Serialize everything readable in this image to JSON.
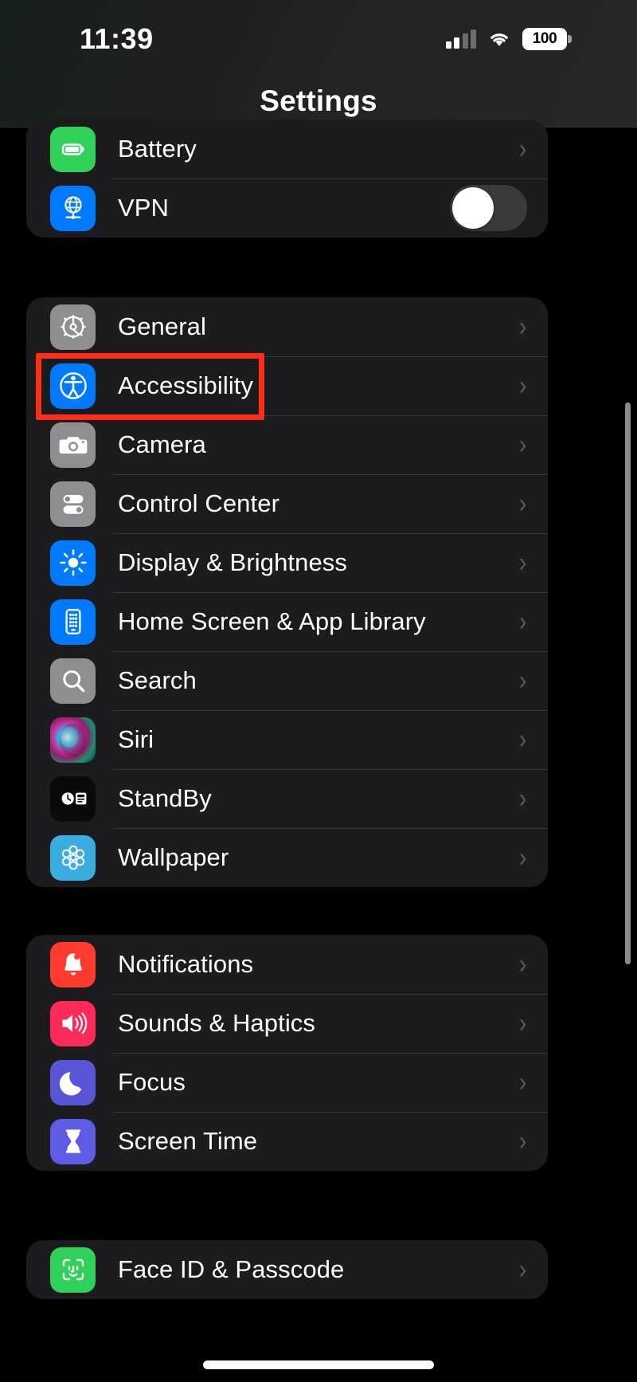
{
  "status_bar": {
    "time": "11:39",
    "cellular_icon": "cellular-signal-icon",
    "wifi_icon": "wifi-icon",
    "battery_percent": "100",
    "battery_icon": "battery-full-icon"
  },
  "nav": {
    "title": "Settings"
  },
  "highlight": {
    "target": "Accessibility",
    "color": "#ff2d16"
  },
  "sections": [
    {
      "id": "section-battery-vpn",
      "rows": [
        {
          "label": "Battery",
          "icon": "battery-icon",
          "icon_bg": "#30d158",
          "accessory": "chevron"
        },
        {
          "label": "VPN",
          "icon": "vpn-globe-icon",
          "icon_bg": "#007aff",
          "accessory": "toggle",
          "toggle_on": false
        }
      ]
    },
    {
      "id": "section-system",
      "rows": [
        {
          "label": "General",
          "icon": "gear-icon",
          "icon_bg": "#8e8e93",
          "accessory": "chevron"
        },
        {
          "label": "Accessibility",
          "icon": "accessibility-icon",
          "icon_bg": "#007aff",
          "accessory": "chevron"
        },
        {
          "label": "Camera",
          "icon": "camera-icon",
          "icon_bg": "#8e8e93",
          "accessory": "chevron"
        },
        {
          "label": "Control Center",
          "icon": "control-center-icon",
          "icon_bg": "#8e8e93",
          "accessory": "chevron"
        },
        {
          "label": "Display & Brightness",
          "icon": "brightness-sun-icon",
          "icon_bg": "#007aff",
          "accessory": "chevron"
        },
        {
          "label": "Home Screen & App Library",
          "icon": "home-screen-icon",
          "icon_bg": "#007aff",
          "accessory": "chevron"
        },
        {
          "label": "Search",
          "icon": "search-icon",
          "icon_bg": "#8e8e93",
          "accessory": "chevron"
        },
        {
          "label": "Siri",
          "icon": "siri-orb-icon",
          "icon_bg": "#2a1230",
          "accessory": "chevron"
        },
        {
          "label": "StandBy",
          "icon": "standby-clock-icon",
          "icon_bg": "#0a0a0a",
          "accessory": "chevron"
        },
        {
          "label": "Wallpaper",
          "icon": "wallpaper-flower-icon",
          "icon_bg": "#3aaee0",
          "accessory": "chevron"
        }
      ]
    },
    {
      "id": "section-notifications",
      "rows": [
        {
          "label": "Notifications",
          "icon": "bell-icon",
          "icon_bg": "#ff3b30",
          "accessory": "chevron"
        },
        {
          "label": "Sounds & Haptics",
          "icon": "speaker-icon",
          "icon_bg": "#fa2a5a",
          "accessory": "chevron"
        },
        {
          "label": "Focus",
          "icon": "moon-icon",
          "icon_bg": "#5856d6",
          "accessory": "chevron"
        },
        {
          "label": "Screen Time",
          "icon": "hourglass-icon",
          "icon_bg": "#5e5ce6",
          "accessory": "chevron"
        }
      ]
    },
    {
      "id": "section-security",
      "rows": [
        {
          "label": "Face ID & Passcode",
          "icon": "face-id-icon",
          "icon_bg": "#30d158",
          "accessory": "chevron"
        }
      ]
    }
  ]
}
